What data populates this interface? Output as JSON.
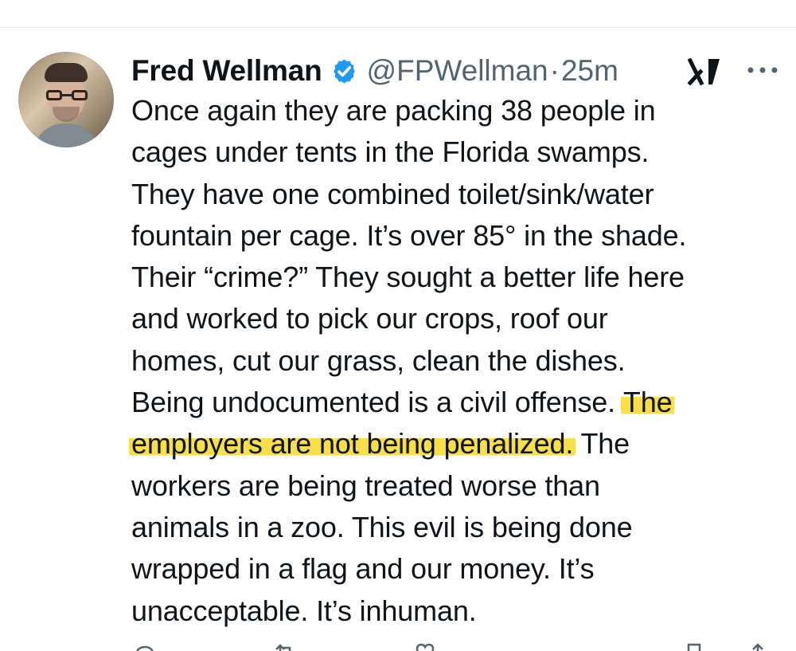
{
  "tweet": {
    "display_name": "Fred Wellman",
    "handle": "@FPWellman",
    "separator": "·",
    "time": "25m",
    "verified": true,
    "text_lines": [
      "Once again they are packing 38 people in",
      "cages under tents in the Florida swamps.",
      "They have one combined toilet/sink/water",
      "fountain per cage. It’s over 85° in the shade.",
      "Their “crime?” They sought a better life here",
      "and worked to pick our crops, roof our",
      "homes, cut our grass, clean the dishes.",
      "Being undocumented is a civil offense. ",
      "The",
      "employers are not being penalized.",
      " The",
      "workers are being treated worse than",
      "animals in a zoo. This evil is being done",
      "wrapped in a flag and our money. It’s",
      "unacceptable. It’s inhuman."
    ]
  },
  "colors": {
    "text": "#0f1419",
    "secondary": "#536471",
    "verified": "#1d9bf0",
    "highlight": "#f6df4b"
  },
  "icons": {
    "verified": "verified-badge-icon",
    "grok": "grok-icon",
    "more": "more-options-icon",
    "reply": "reply-icon",
    "repost": "repost-icon",
    "like": "like-icon",
    "bookmark": "bookmark-icon",
    "share": "share-icon"
  }
}
